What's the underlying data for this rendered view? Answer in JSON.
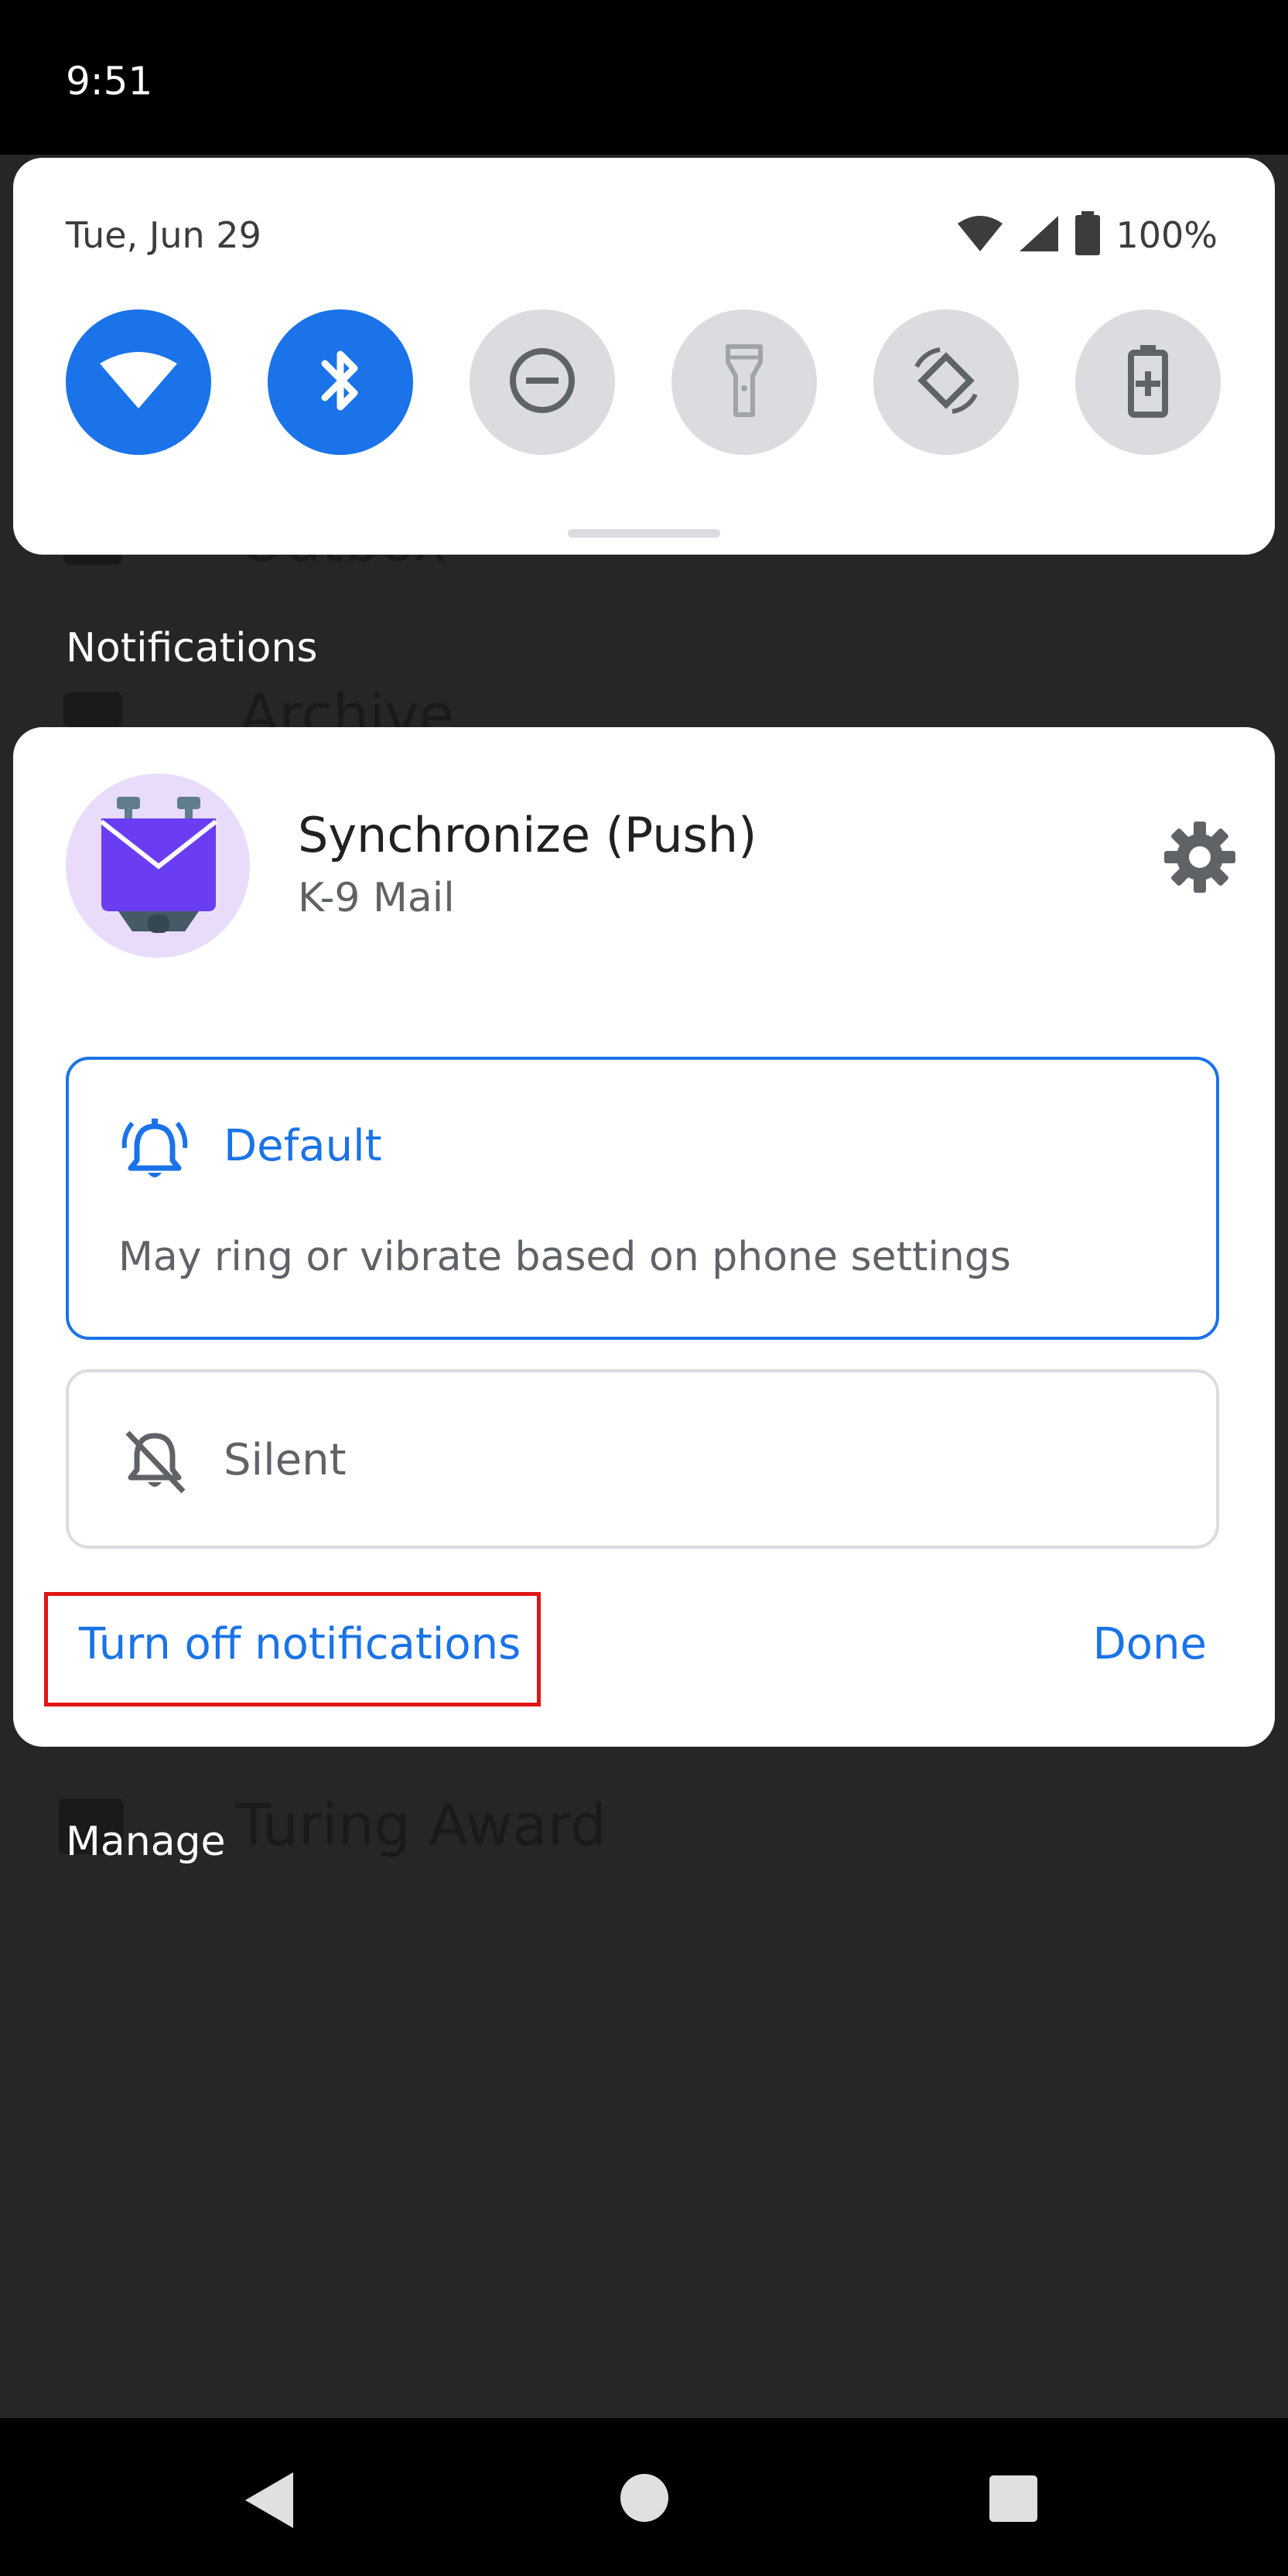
{
  "status_bar": {
    "time": "9:51"
  },
  "quick_settings": {
    "date": "Tue, Jun 29",
    "battery_text": "100%",
    "tiles": [
      {
        "name": "wifi",
        "icon": "wifi-icon",
        "state": "on"
      },
      {
        "name": "bluetooth",
        "icon": "bluetooth-icon",
        "state": "on"
      },
      {
        "name": "do-not-disturb",
        "icon": "do-not-disturb-icon",
        "state": "off"
      },
      {
        "name": "flashlight",
        "icon": "flashlight-icon",
        "state": "off"
      },
      {
        "name": "auto-rotate",
        "icon": "auto-rotate-icon",
        "state": "off"
      },
      {
        "name": "battery-saver",
        "icon": "battery-saver-icon",
        "state": "off"
      }
    ]
  },
  "background": {
    "items": [
      "Outbox",
      "Archive",
      "Turing Award"
    ]
  },
  "sections": {
    "notifications_label": "Notifications",
    "manage_label": "Manage"
  },
  "notification": {
    "app_icon": "k9-mail-icon",
    "title": "Synchronize (Push)",
    "app_name": "K-9 Mail",
    "settings_icon": "gear-icon",
    "options": {
      "default": {
        "label": "Default",
        "icon": "bell-alert-icon",
        "description": "May ring or vibrate based on phone settings"
      },
      "silent": {
        "label": "Silent",
        "icon": "bell-off-icon"
      }
    },
    "turn_off_label": "Turn off notifications",
    "done_label": "Done"
  },
  "nav_bar": {
    "back": "back-icon",
    "home": "home-icon",
    "recents": "recents-icon"
  },
  "colors": {
    "accent": "#1a73e8",
    "tile_off": "#dadce0",
    "highlight_box": "#e01515",
    "background": "#262626"
  }
}
